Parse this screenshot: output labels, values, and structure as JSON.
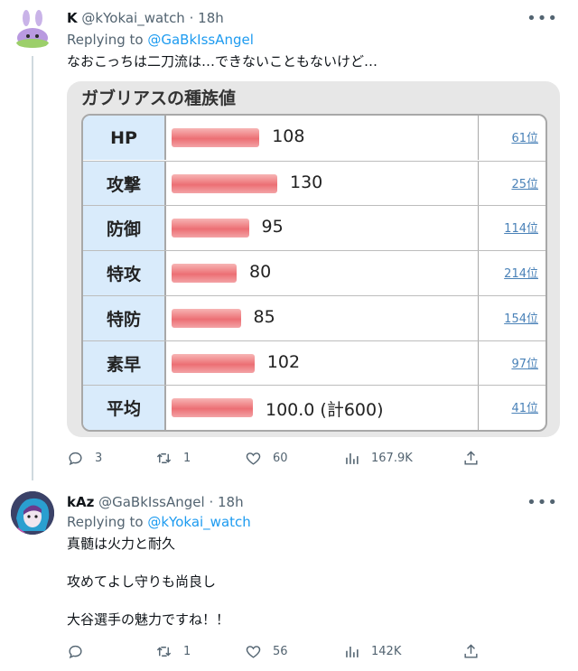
{
  "tweets": [
    {
      "author": {
        "name": "K",
        "handle": "@kYokai_watch",
        "time": "18h"
      },
      "replying_label": "Replying to",
      "replying_to": "@GaBkIssAngel",
      "text": "なおこっちは二刀流は…できないこともないけど…",
      "card": {
        "title": "ガブリアスの種族値",
        "rows": [
          {
            "label": "HP",
            "value": "108",
            "rank": "61位",
            "bar": 108
          },
          {
            "label": "攻撃",
            "value": "130",
            "rank": "25位",
            "bar": 130
          },
          {
            "label": "防御",
            "value": "95",
            "rank": "114位",
            "bar": 95
          },
          {
            "label": "特攻",
            "value": "80",
            "rank": "214位",
            "bar": 80
          },
          {
            "label": "特防",
            "value": "85",
            "rank": "154位",
            "bar": 85
          },
          {
            "label": "素早",
            "value": "102",
            "rank": "97位",
            "bar": 102
          },
          {
            "label": "平均",
            "value": "100.0 (計600)",
            "rank": "41位",
            "bar": 100
          }
        ]
      },
      "stats": {
        "replies": "3",
        "retweets": "1",
        "likes": "60",
        "views": "167.9K"
      }
    },
    {
      "author": {
        "name": "kAz",
        "handle": "@GaBkIssAngel",
        "time": "18h"
      },
      "replying_label": "Replying to",
      "replying_to": "@kYokai_watch",
      "text_lines": [
        "真髄は火力と耐久",
        "攻めてよし守りも尚良し",
        "大谷選手の魅力ですね！！"
      ],
      "stats": {
        "replies": "",
        "retweets": "1",
        "likes": "56",
        "views": "142K"
      }
    }
  ],
  "more_icon": "more-icon",
  "colors": {
    "link": "#1d9bf0",
    "muted": "#536471",
    "bar": "#ec6f74",
    "label_bg": "#d9ebfb"
  }
}
